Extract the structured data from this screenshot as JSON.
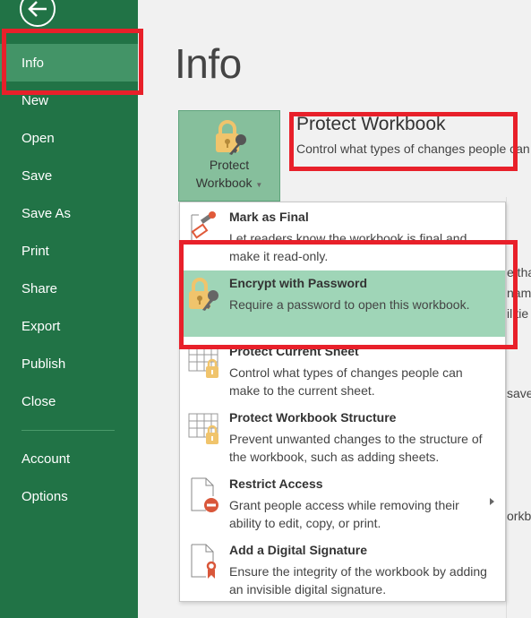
{
  "sidebar": {
    "back_icon": "arrow-left-circle-icon",
    "items": [
      {
        "label": "Info",
        "active": true
      },
      {
        "label": "New"
      },
      {
        "label": "Open"
      },
      {
        "label": "Save"
      },
      {
        "label": "Save As"
      },
      {
        "label": "Print"
      },
      {
        "label": "Share"
      },
      {
        "label": "Export"
      },
      {
        "label": "Publish"
      },
      {
        "label": "Close"
      }
    ],
    "bottom_items": [
      {
        "label": "Account"
      },
      {
        "label": "Options"
      }
    ]
  },
  "main": {
    "title": "Info",
    "protect_button": {
      "line1": "Protect",
      "line2": "Workbook",
      "icon": "lock-key-icon"
    },
    "protect_section": {
      "title": "Protect Workbook",
      "description": "Control what types of changes people can make to this workbook."
    },
    "background_fragments": [
      "e that",
      "nam",
      "ilitie",
      "saved",
      "orkb"
    ]
  },
  "menu": {
    "items": [
      {
        "title": "Mark as Final",
        "description": "Let readers know the workbook is final and make it read-only.",
        "icon": "stamp-icon"
      },
      {
        "title": "Encrypt with Password",
        "description": "Require a password to open this workbook.",
        "icon": "lock-key-icon",
        "highlighted": true
      },
      {
        "title": "Protect Current Sheet",
        "description": "Control what types of changes people can make to the current sheet.",
        "icon": "sheet-lock-icon"
      },
      {
        "title": "Protect Workbook Structure",
        "description": "Prevent unwanted changes to the structure of the workbook, such as adding sheets.",
        "icon": "workbook-lock-icon"
      },
      {
        "title": "Restrict Access",
        "description": "Grant people access while removing their ability to edit, copy, or print.",
        "icon": "restrict-icon",
        "has_submenu": true
      },
      {
        "title": "Add a Digital Signature",
        "description": "Ensure the integrity of the workbook by adding an invisible digital signature.",
        "icon": "ribbon-icon"
      }
    ]
  },
  "colors": {
    "sidebar": "#217346",
    "sidebar_active": "#439467",
    "highlight": "#9fd5b7",
    "annotation": "#e8202a"
  }
}
